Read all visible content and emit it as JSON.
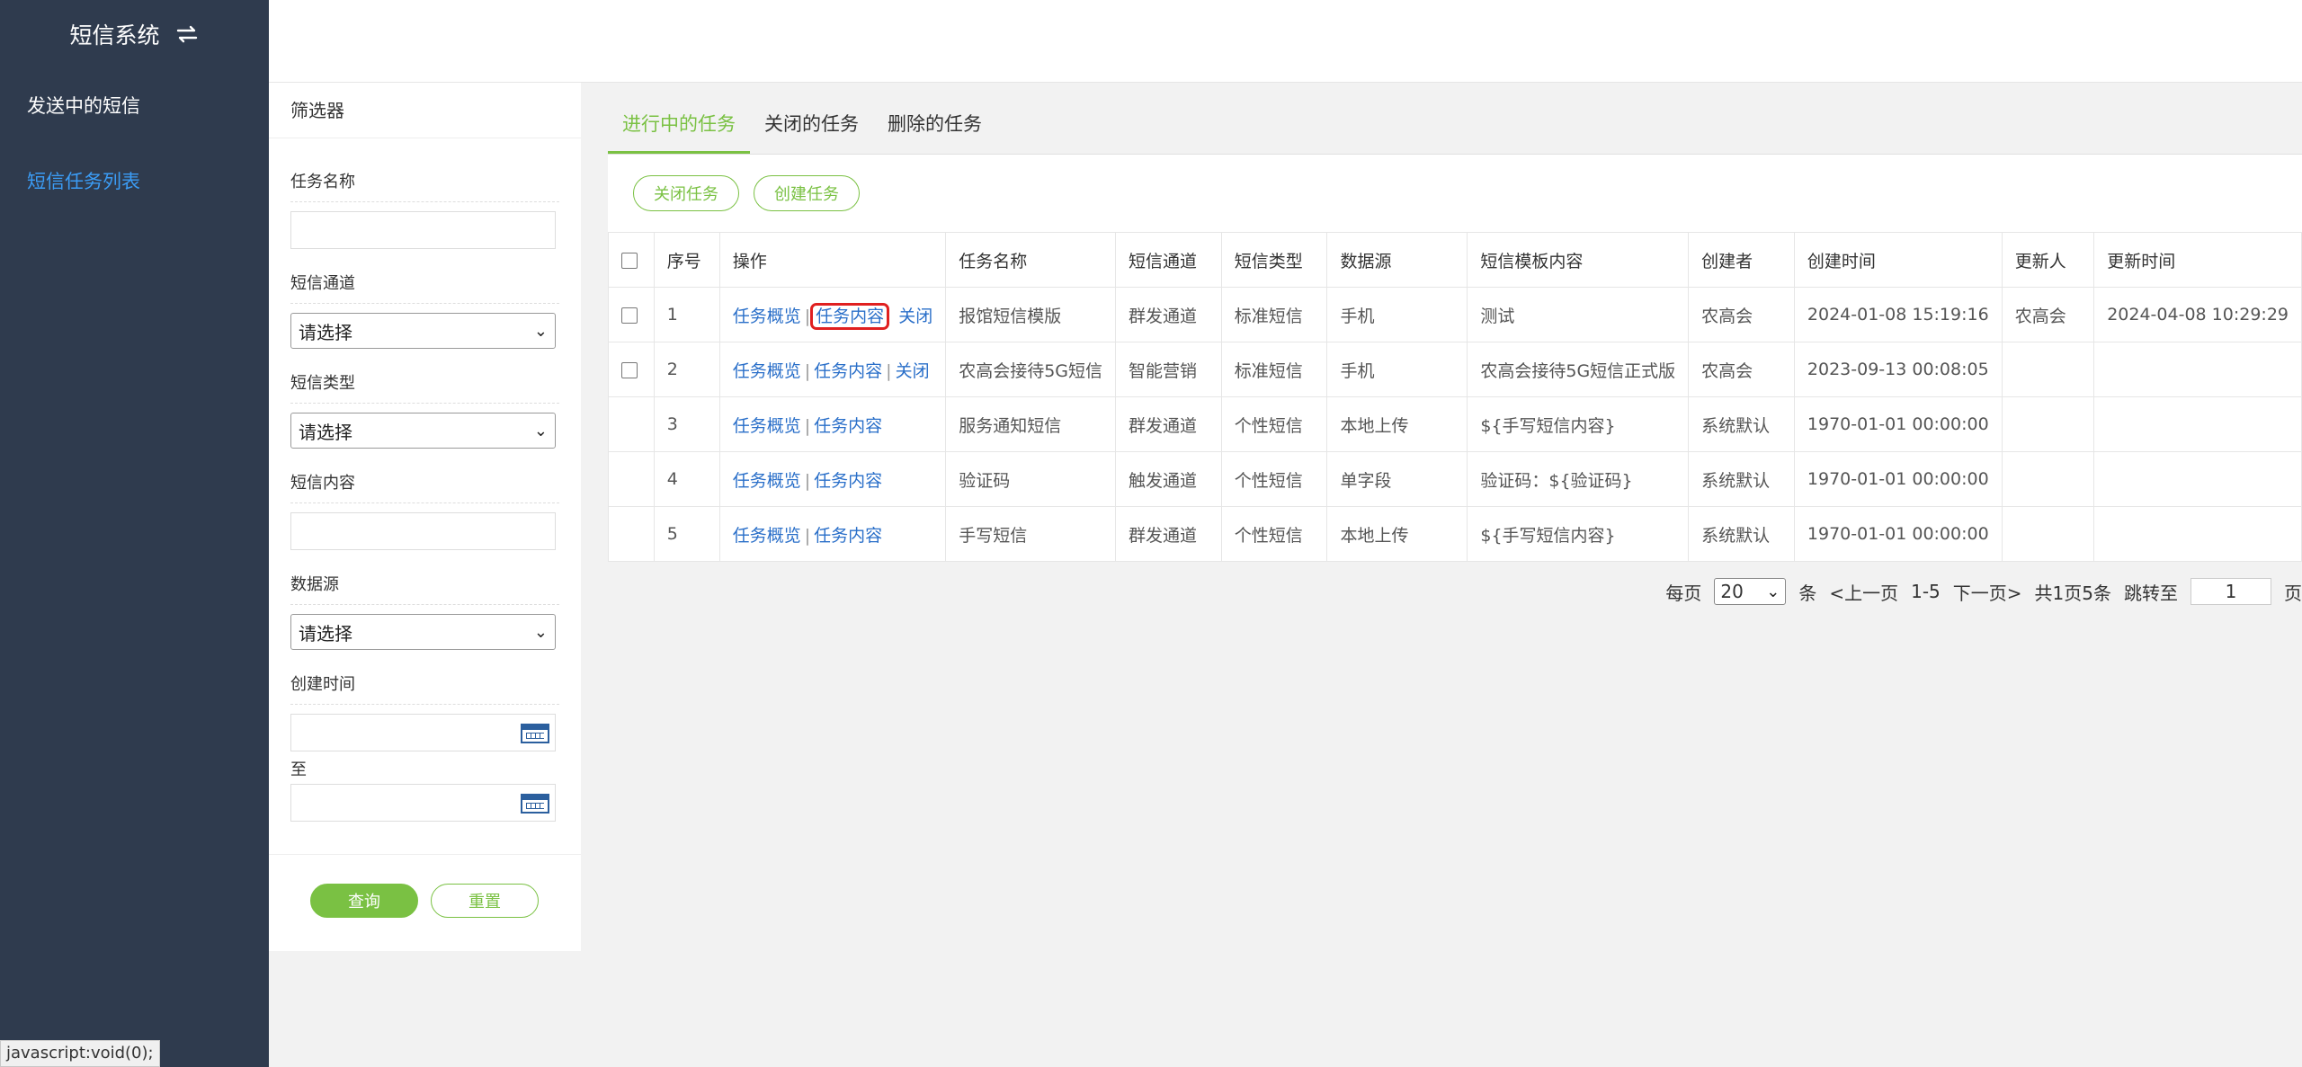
{
  "app": {
    "title": "短信系统",
    "icon": "swap-icon"
  },
  "sidebar": {
    "items": [
      {
        "label": "发送中的短信",
        "active": false
      },
      {
        "label": "短信任务列表",
        "active": true
      }
    ]
  },
  "status_bar": {
    "text": "javascript:void(0);"
  },
  "filter": {
    "title": "筛选器",
    "task_name_label": "任务名称",
    "channel_label": "短信通道",
    "channel_value": "请选择",
    "type_label": "短信类型",
    "type_value": "请选择",
    "content_label": "短信内容",
    "datasource_label": "数据源",
    "datasource_value": "请选择",
    "created_label": "创建时间",
    "to_label": "至",
    "query_button": "查询",
    "reset_button": "重置"
  },
  "tabs": [
    {
      "label": "进行中的任务",
      "active": true
    },
    {
      "label": "关闭的任务",
      "active": false
    },
    {
      "label": "删除的任务",
      "active": false
    }
  ],
  "actions": {
    "close_task": "关闭任务",
    "create_task": "创建任务"
  },
  "table": {
    "columns": [
      "序号",
      "操作",
      "任务名称",
      "短信通道",
      "短信类型",
      "数据源",
      "短信模板内容",
      "创建者",
      "创建时间",
      "更新人",
      "更新时间"
    ],
    "rows": [
      {
        "no": "1",
        "ops": [
          "任务概览",
          "任务内容",
          "关闭"
        ],
        "name": "报馆短信模版",
        "channel": "群发通道",
        "type": "标准短信",
        "source": "手机",
        "template": "测试",
        "creator": "农高会",
        "created": "2024-01-08 15:19:16",
        "updater": "农高会",
        "updated": "2024-04-08 10:29:29",
        "checkbox": true
      },
      {
        "no": "2",
        "ops": [
          "任务概览",
          "任务内容",
          "关闭"
        ],
        "name": "农高会接待5G短信",
        "channel": "智能营销",
        "type": "标准短信",
        "source": "手机",
        "template": "农高会接待5G短信正式版",
        "creator": "农高会",
        "created": "2023-09-13 00:08:05",
        "updater": "",
        "updated": "",
        "checkbox": true
      },
      {
        "no": "3",
        "ops": [
          "任务概览",
          "任务内容"
        ],
        "name": "服务通知短信",
        "channel": "群发通道",
        "type": "个性短信",
        "source": "本地上传",
        "template": "${手写短信内容}",
        "creator": "系统默认",
        "created": "1970-01-01 00:00:00",
        "updater": "",
        "updated": "",
        "checkbox": false
      },
      {
        "no": "4",
        "ops": [
          "任务概览",
          "任务内容"
        ],
        "name": "验证码",
        "channel": "触发通道",
        "type": "个性短信",
        "source": "单字段",
        "template": "验证码：${验证码}",
        "creator": "系统默认",
        "created": "1970-01-01 00:00:00",
        "updater": "",
        "updated": "",
        "checkbox": false
      },
      {
        "no": "5",
        "ops": [
          "任务概览",
          "任务内容"
        ],
        "name": "手写短信",
        "channel": "群发通道",
        "type": "个性短信",
        "source": "本地上传",
        "template": "${手写短信内容}",
        "creator": "系统默认",
        "created": "1970-01-01 00:00:00",
        "updater": "",
        "updated": "",
        "checkbox": false
      }
    ]
  },
  "pager": {
    "per_page_label": "每页",
    "per_page_value": "20",
    "unit": "条",
    "prev": "<上一页",
    "range": "1-5",
    "next": "下一页>",
    "summary": "共1页5条",
    "jump_label": "跳转至",
    "jump_value": "1",
    "page_unit": "页"
  }
}
